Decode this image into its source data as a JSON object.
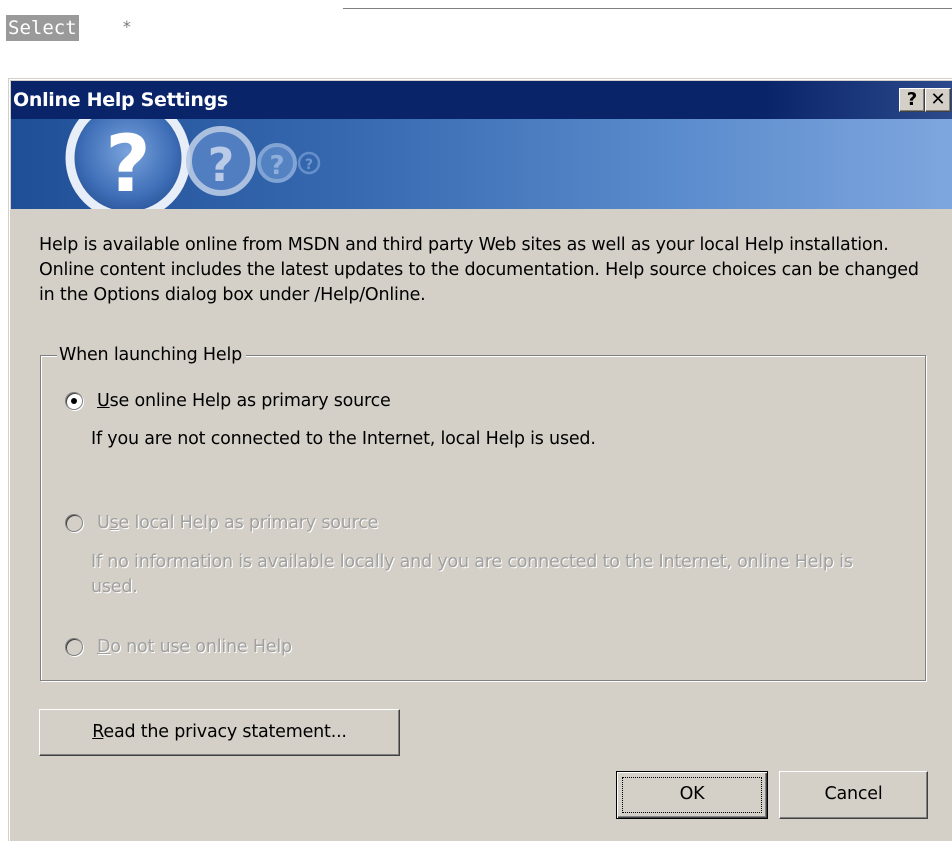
{
  "editor": {
    "select_keyword": "Select",
    "star": "*"
  },
  "dialog": {
    "title": "Online Help Settings",
    "help_button": "?",
    "close_button": "✕",
    "description": "Help is available online from MSDN and third party Web sites as well as your local Help installation. Online content includes the latest updates to the documentation. Help source choices can be changed in the Options dialog box under /Help/Online.",
    "group_label": "When launching Help",
    "options": [
      {
        "access_key": "U",
        "label_rest": "se online Help as primary source",
        "description": "If you are not connected to the Internet, local Help is used.",
        "selected": true,
        "enabled": true
      },
      {
        "label_pre": "U",
        "access_key": "s",
        "label_rest": "e local Help as primary source",
        "description": "If no information is available locally and you are connected to the Internet, online Help is used.",
        "selected": false,
        "enabled": false
      },
      {
        "access_key": "D",
        "label_rest": "o not use online Help",
        "selected": false,
        "enabled": false
      }
    ],
    "privacy_button": {
      "access_key": "R",
      "label_rest": "ead the privacy statement..."
    },
    "ok_button": "OK",
    "cancel_button": "Cancel"
  }
}
